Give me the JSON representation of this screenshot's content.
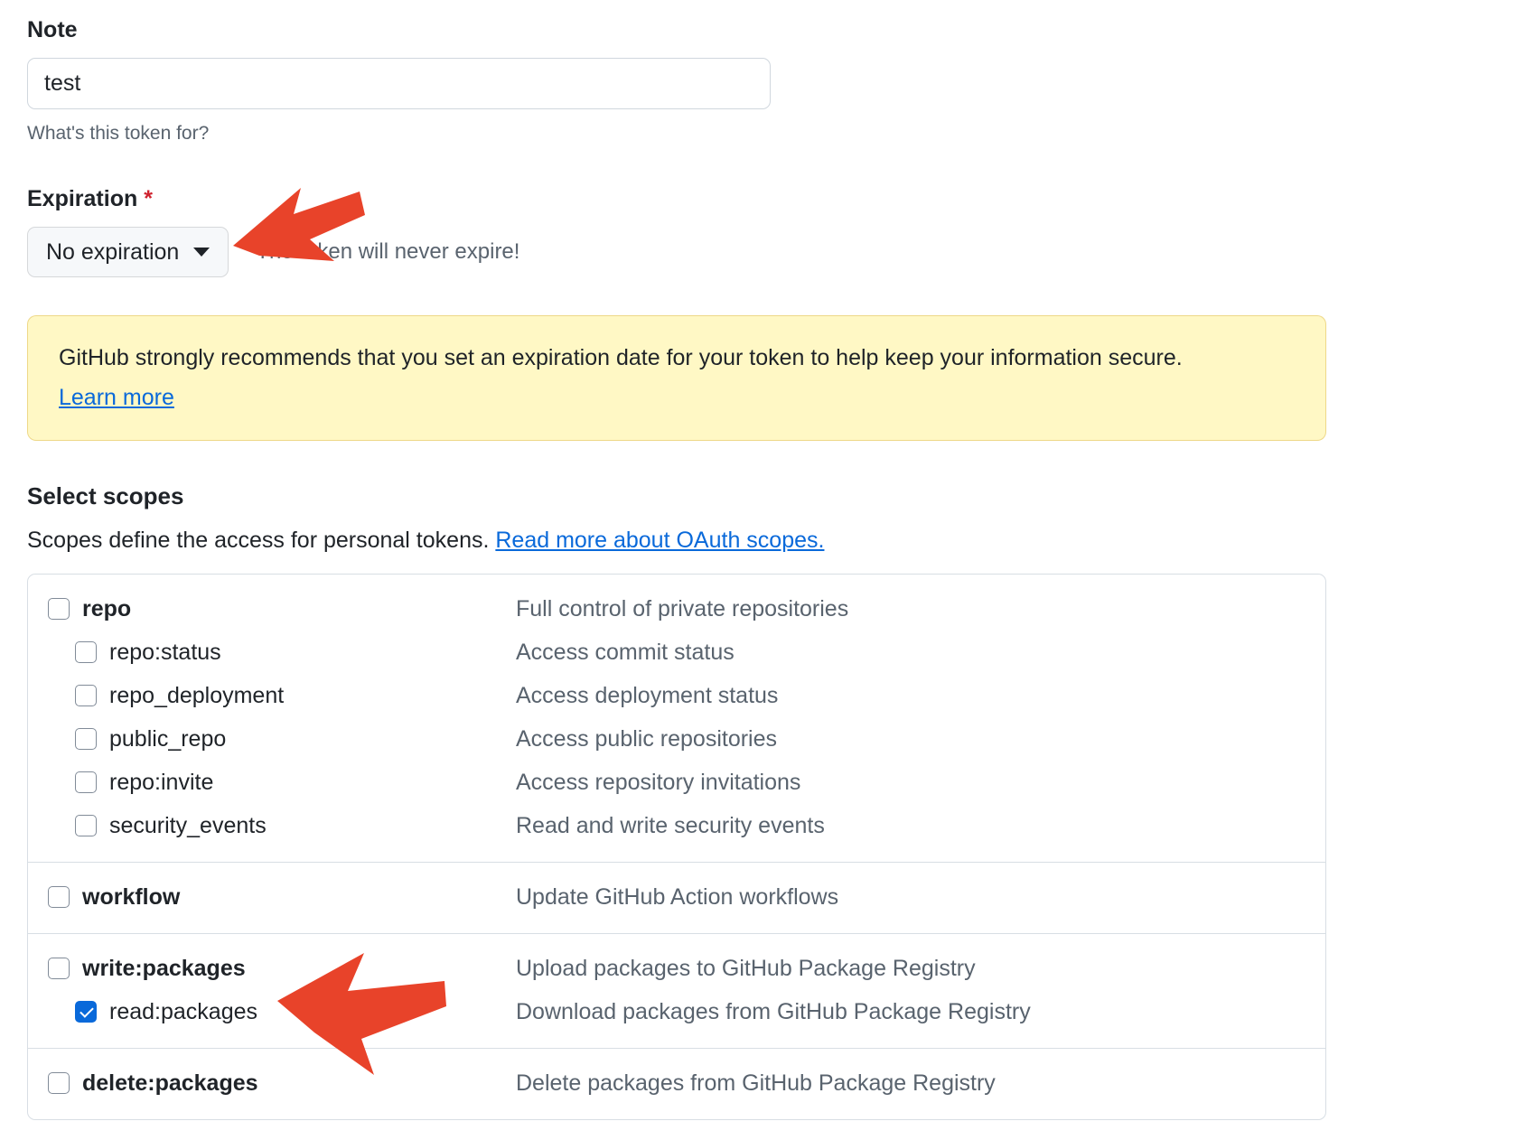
{
  "note": {
    "label": "Note",
    "value": "test",
    "hint": "What's this token for?"
  },
  "expiration": {
    "label": "Expiration",
    "required_marker": "*",
    "selected": "No expiration",
    "note": "The token will never expire!"
  },
  "warning": {
    "text": "GitHub strongly recommends that you set an expiration date for your token to help keep your information secure.",
    "link": "Learn more"
  },
  "scopes": {
    "heading": "Select scopes",
    "description_prefix": "Scopes define the access for personal tokens. ",
    "description_link": "Read more about OAuth scopes.",
    "groups": [
      {
        "items": [
          {
            "name": "repo",
            "desc": "Full control of private repositories",
            "checked": false,
            "child": false,
            "bold": true
          },
          {
            "name": "repo:status",
            "desc": "Access commit status",
            "checked": false,
            "child": true,
            "bold": false
          },
          {
            "name": "repo_deployment",
            "desc": "Access deployment status",
            "checked": false,
            "child": true,
            "bold": false
          },
          {
            "name": "public_repo",
            "desc": "Access public repositories",
            "checked": false,
            "child": true,
            "bold": false
          },
          {
            "name": "repo:invite",
            "desc": "Access repository invitations",
            "checked": false,
            "child": true,
            "bold": false
          },
          {
            "name": "security_events",
            "desc": "Read and write security events",
            "checked": false,
            "child": true,
            "bold": false
          }
        ]
      },
      {
        "items": [
          {
            "name": "workflow",
            "desc": "Update GitHub Action workflows",
            "checked": false,
            "child": false,
            "bold": true
          }
        ]
      },
      {
        "items": [
          {
            "name": "write:packages",
            "desc": "Upload packages to GitHub Package Registry",
            "checked": false,
            "child": false,
            "bold": true
          },
          {
            "name": "read:packages",
            "desc": "Download packages from GitHub Package Registry",
            "checked": true,
            "child": true,
            "bold": false
          }
        ]
      },
      {
        "items": [
          {
            "name": "delete:packages",
            "desc": "Delete packages from GitHub Package Registry",
            "checked": false,
            "child": false,
            "bold": true
          }
        ]
      }
    ]
  },
  "annotations": {
    "arrow_color": "#e8432a",
    "arrows": [
      {
        "name": "arrow-to-expiration-dropdown",
        "points_at": "No expiration"
      },
      {
        "name": "arrow-to-read-packages-checkbox",
        "points_at": "read:packages"
      }
    ]
  },
  "colors": {
    "link": "#0969da",
    "warning_bg": "#fff8c5",
    "required": "#cf222e",
    "muted_text": "#59636e",
    "checkbox_checked": "#0969da"
  }
}
